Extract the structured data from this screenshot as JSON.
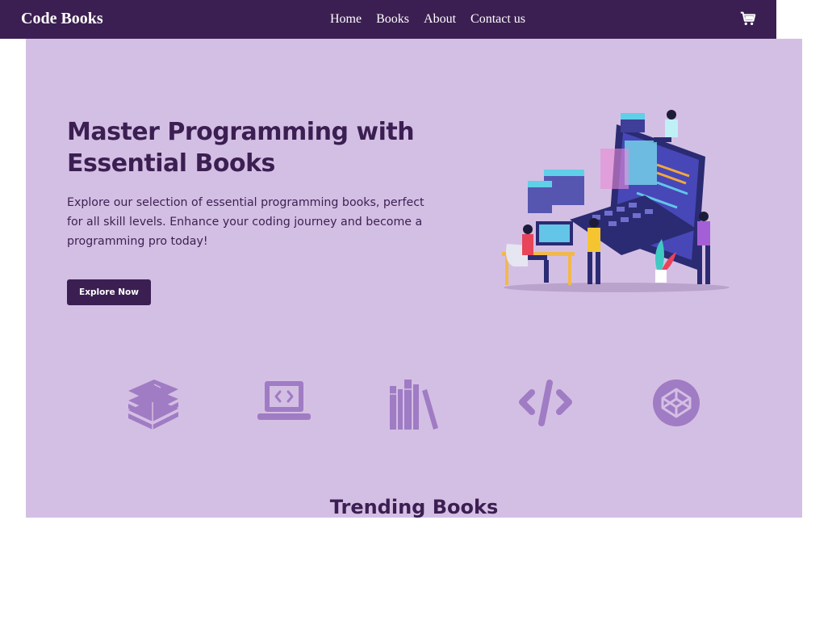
{
  "nav": {
    "brand": "Code Books",
    "links": [
      "Home",
      "Books",
      "About",
      "Contact us"
    ]
  },
  "hero": {
    "title": "Master Programming with Essential Books",
    "description": "Explore our selection of essential programming books, perfect for all skill levels. Enhance your coding journey and become a programming pro today!",
    "cta_label": "Explore Now"
  },
  "feature_icons": [
    "books-stack-icon",
    "laptop-code-icon",
    "bookshelf-icon",
    "code-brackets-icon",
    "codepen-icon"
  ],
  "trending": {
    "title": "Trending Books"
  },
  "colors": {
    "primary": "#3c1f52",
    "hero_bg": "#d4bfe4",
    "icon_color": "#a07cc4"
  }
}
